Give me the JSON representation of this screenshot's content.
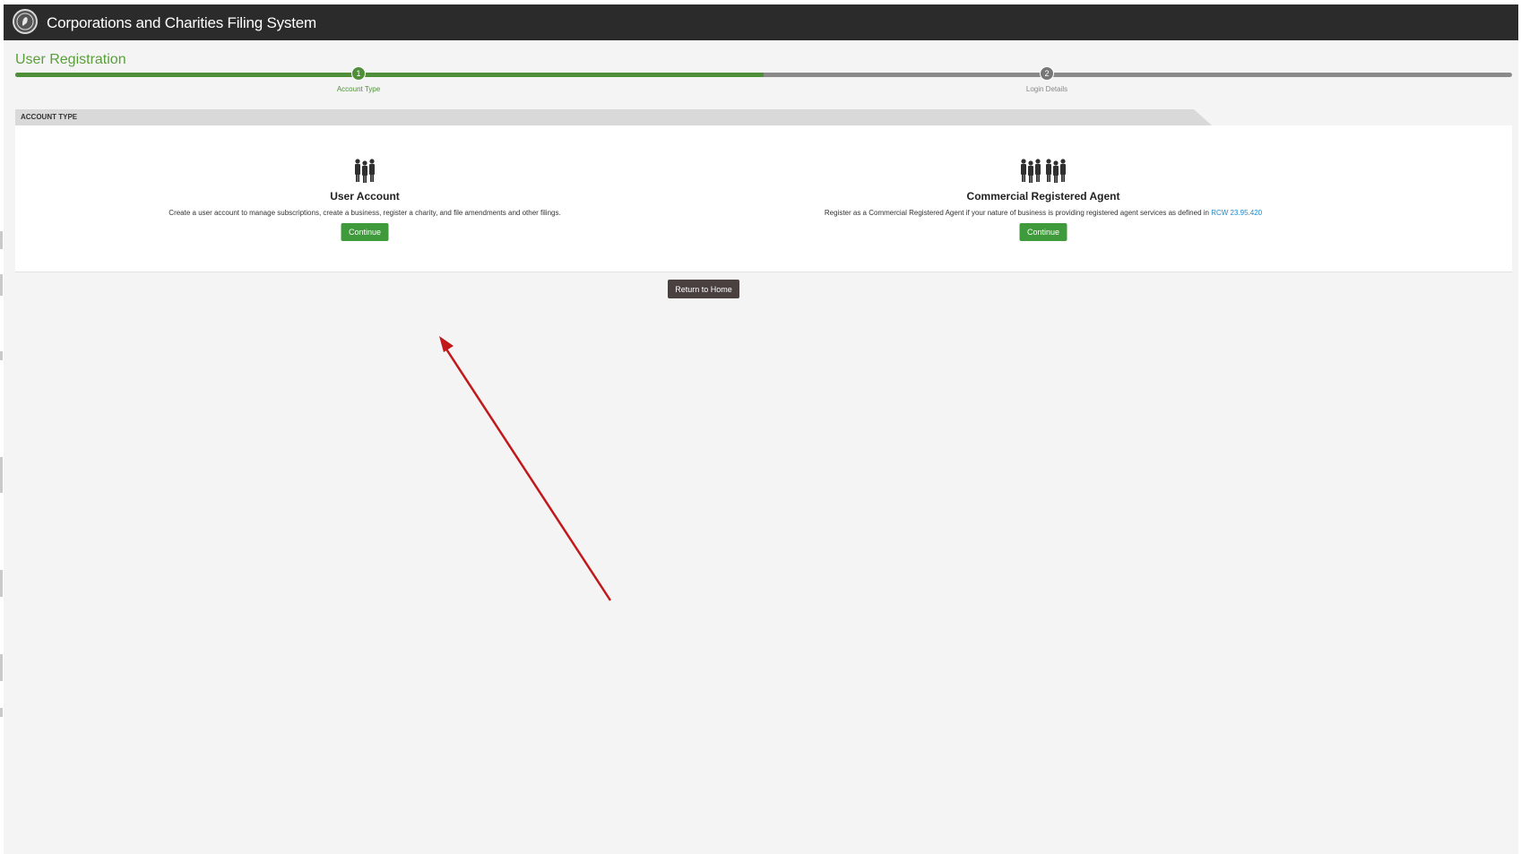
{
  "header": {
    "app_title": "Corporations and Charities Filing System",
    "logo_icon": "state-seal-icon"
  },
  "page": {
    "title": "User Registration"
  },
  "wizard": {
    "progress_fraction": 0.5,
    "steps": [
      {
        "number": "1",
        "label": "Account Type",
        "state": "active"
      },
      {
        "number": "2",
        "label": "Login Details",
        "state": "inactive"
      }
    ]
  },
  "section": {
    "heading": "ACCOUNT TYPE"
  },
  "options": [
    {
      "icon": "group-people-icon",
      "title": "User Account",
      "description": "Create a user account to manage subscriptions, create a business, register a charity, and file amendments and other filings.",
      "button_label": "Continue"
    },
    {
      "icon": "two-groups-people-icon",
      "title": "Commercial Registered Agent",
      "description": "Register as a Commercial Registered Agent if your nature of business is providing registered agent services as defined in ",
      "link_text": "RCW 23.95.420",
      "button_label": "Continue"
    }
  ],
  "footer": {
    "return_label": "Return to Home"
  },
  "colors": {
    "header_bg": "#2b2b2b",
    "accent_green": "#4f8f3a",
    "button_green": "#3f9a3c",
    "return_button": "#4a4040",
    "annotation_arrow": "#c0181b",
    "link": "#1b8ad1"
  }
}
